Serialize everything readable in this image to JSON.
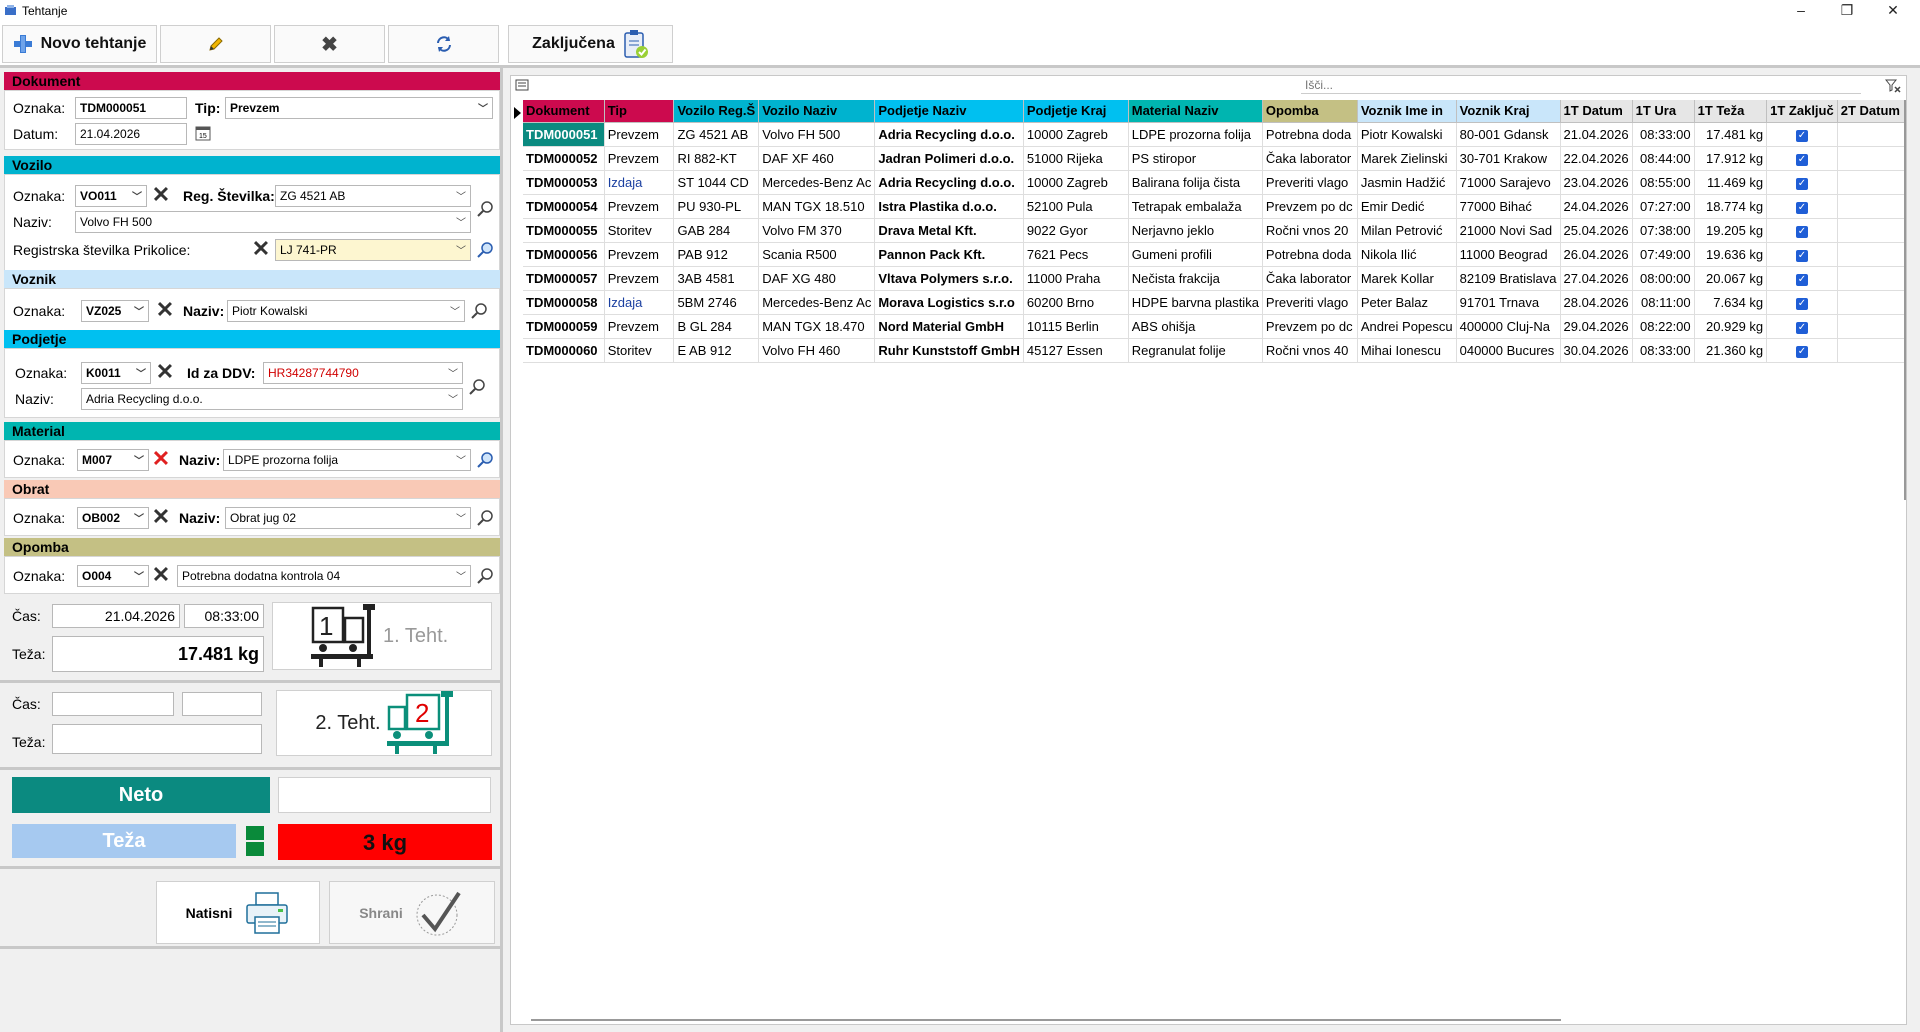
{
  "window": {
    "title": "Tehtanje"
  },
  "toolbar": {
    "new_label": "Novo tehtanje",
    "closed_label": "Zaključena"
  },
  "dokument": {
    "header": "Dokument",
    "oznaka_label": "Oznaka:",
    "oznaka": "TDM000051",
    "tip_label": "Tip:",
    "tip": "Prevzem",
    "datum_label": "Datum:",
    "datum": "21.04.2026"
  },
  "vozilo": {
    "header": "Vozilo",
    "oznaka_label": "Oznaka:",
    "oznaka": "VO011",
    "reg_label": "Reg. Številka:",
    "reg": "ZG 4521 AB",
    "naziv_label": "Naziv:",
    "naziv": "Volvo FH 500",
    "prikolica_label": "Registrska številka Prikolice:",
    "prikolica": "LJ 741-PR"
  },
  "voznik": {
    "header": "Voznik",
    "oznaka_label": "Oznaka:",
    "oznaka": "VZ025",
    "naziv_label": "Naziv:",
    "naziv": "Piotr Kowalski"
  },
  "podjetje": {
    "header": "Podjetje",
    "oznaka_label": "Oznaka:",
    "oznaka": "K0011",
    "ddv_label": "Id za DDV:",
    "ddv": "HR34287744790",
    "naziv_label": "Naziv:",
    "naziv": "Adria Recycling d.o.o."
  },
  "material": {
    "header": "Material",
    "oznaka_label": "Oznaka:",
    "oznaka": "M007",
    "naziv_label": "Naziv:",
    "naziv": "LDPE prozorna folija"
  },
  "obrat": {
    "header": "Obrat",
    "oznaka_label": "Oznaka:",
    "oznaka": "OB002",
    "naziv_label": "Naziv:",
    "naziv": "Obrat jug 02"
  },
  "opomba": {
    "header": "Opomba",
    "oznaka_label": "Oznaka:",
    "oznaka": "O004",
    "naziv": "Potrebna dodatna kontrola 04"
  },
  "teht1": {
    "cas_label": "Čas:",
    "datum": "21.04.2026",
    "ura": "08:33:00",
    "teza_label": "Teža:",
    "teza": "17.481 kg",
    "num": "1",
    "button_label": "1. Teht."
  },
  "teht2": {
    "cas_label": "Čas:",
    "teza_label": "Teža:",
    "num": "2",
    "button_label": "2. Teht."
  },
  "neto": {
    "label": "Neto",
    "teza_label": "Teža",
    "teza_value": "3 kg"
  },
  "actions": {
    "print_label": "Natisni",
    "save_label": "Shrani"
  },
  "search": {
    "placeholder": "Išči..."
  },
  "grid": {
    "columns": [
      "Dokument",
      "Tip",
      "Vozilo Reg.Š",
      "Vozilo Naziv",
      "Podjetje Naziv",
      "Podjetje Kraj",
      "Material Naziv",
      "Opomba",
      "Voznik Ime in",
      "Voznik Kraj",
      "1T Datum",
      "1T Ura",
      "1T Teža",
      "1T Zaključ",
      "2T Datum"
    ],
    "header_colors": [
      "#cc0a4e",
      "#cc0a4e",
      "#00b3cf",
      "#00b3cf",
      "#00c0f0",
      "#00c0f0",
      "#00b5b0",
      "#c4c084",
      "#c9e6fa",
      "#c9e6fa",
      "#e6e6e6",
      "#e6e6e6",
      "#e6e6e6",
      "#e6e6e6",
      "#e6e6e6"
    ],
    "rows": [
      [
        "TDM000051",
        "Prevzem",
        "ZG 4521 AB",
        "Volvo FH 500",
        "Adria Recycling d.o.o.",
        "10000 Zagreb",
        "LDPE prozorna folija",
        "Potrebna doda",
        "Piotr Kowalski",
        "80-001 Gdansk",
        "21.04.2026",
        "08:33:00",
        "17.481 kg"
      ],
      [
        "TDM000052",
        "Prevzem",
        "RI 882-KT",
        "DAF XF 460",
        "Jadran Polimeri d.o.o.",
        "51000 Rijeka",
        "PS stiropor",
        "Čaka laborator",
        "Marek Zielinski",
        "30-701 Krakow",
        "22.04.2026",
        "08:44:00",
        "17.912 kg"
      ],
      [
        "TDM000053",
        "Izdaja",
        "ST 1044 CD",
        "Mercedes-Benz Ac",
        "Adria Recycling d.o.o.",
        "10000 Zagreb",
        "Balirana folija čista",
        "Preveriti vlago",
        "Jasmin Hadžić",
        "71000 Sarajevo",
        "23.04.2026",
        "08:55:00",
        "11.469 kg"
      ],
      [
        "TDM000054",
        "Prevzem",
        "PU 930-PL",
        "MAN TGX 18.510",
        "Istra Plastika d.o.o.",
        "52100 Pula",
        "Tetrapak embalaža",
        "Prevzem po dc",
        "Emir Dedić",
        "77000 Bihać",
        "24.04.2026",
        "07:27:00",
        "18.774 kg"
      ],
      [
        "TDM000055",
        "Storitev",
        "GAB 284",
        "Volvo FM 370",
        "Drava Metal Kft.",
        "9022 Gyor",
        "Nerjavno jeklo",
        "Ročni vnos 20",
        "Milan Petrović",
        "21000 Novi Sad",
        "25.04.2026",
        "07:38:00",
        "19.205 kg"
      ],
      [
        "TDM000056",
        "Prevzem",
        "PAB 912",
        "Scania R500",
        "Pannon Pack Kft.",
        "7621 Pecs",
        "Gumeni profili",
        "Potrebna doda",
        "Nikola Ilić",
        "11000 Beograd",
        "26.04.2026",
        "07:49:00",
        "19.636 kg"
      ],
      [
        "TDM000057",
        "Prevzem",
        "3AB 4581",
        "DAF XG 480",
        "Vltava Polymers s.r.o.",
        "11000 Praha",
        "Nečista frakcija",
        "Čaka laborator",
        "Marek Kollar",
        "82109 Bratislava",
        "27.04.2026",
        "08:00:00",
        "20.067 kg"
      ],
      [
        "TDM000058",
        "Izdaja",
        "5BM 2746",
        "Mercedes-Benz Ac",
        "Morava Logistics s.r.o",
        "60200 Brno",
        "HDPE barvna plastika",
        "Preveriti vlago",
        "Peter Balaz",
        "91701 Trnava",
        "28.04.2026",
        "08:11:00",
        "7.634 kg"
      ],
      [
        "TDM000059",
        "Prevzem",
        "B GL 284",
        "MAN TGX 18.470",
        "Nord Material GmbH",
        "10115 Berlin",
        "ABS ohišja",
        "Prevzem po dc",
        "Andrei Popescu",
        "400000 Cluj-Na",
        "29.04.2026",
        "08:22:00",
        "20.929 kg"
      ],
      [
        "TDM000060",
        "Storitev",
        "E AB 912",
        "Volvo FH 460",
        "Ruhr Kunststoff GmbH",
        "45127 Essen",
        "Regranulat folije",
        "Ročni vnos 40",
        "Mihai Ionescu",
        "040000 Bucures",
        "30.04.2026",
        "08:33:00",
        "21.360 kg"
      ]
    ]
  }
}
